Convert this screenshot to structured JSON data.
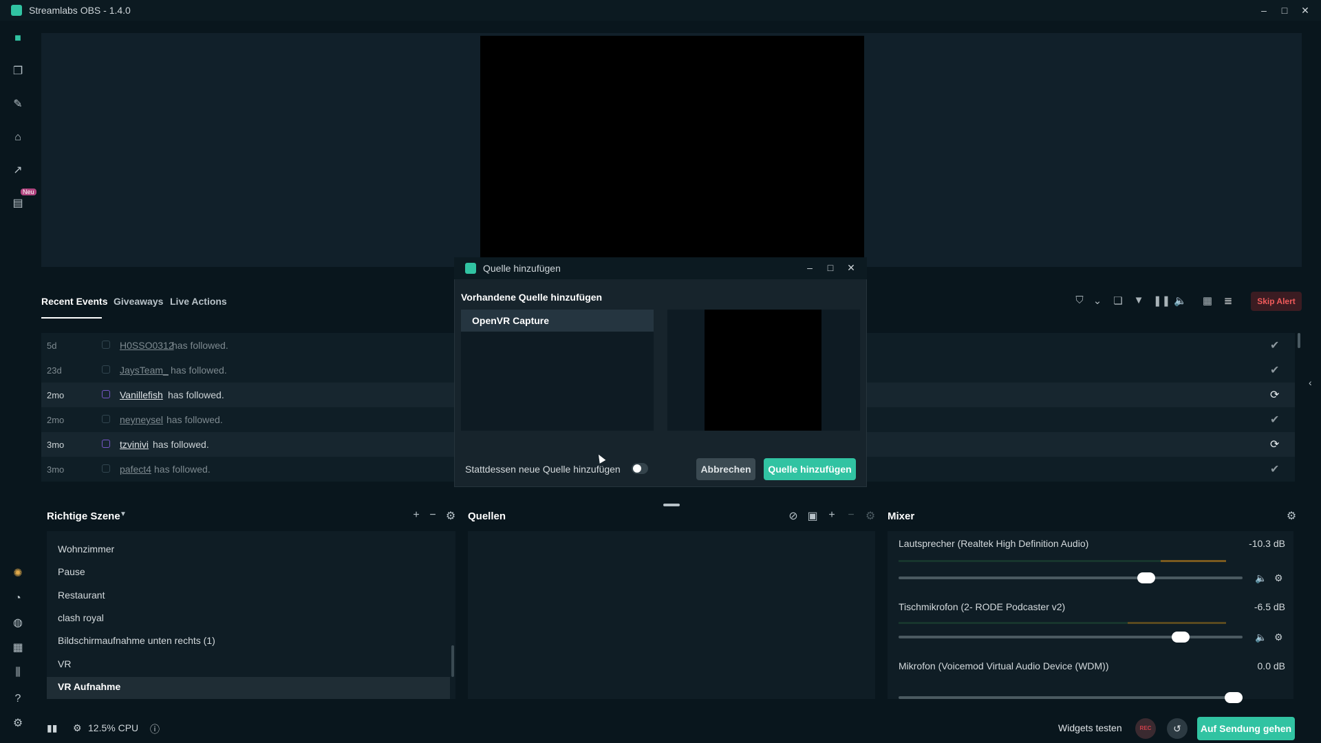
{
  "window": {
    "title": "Streamlabs OBS - 1.4.0",
    "controls": [
      "–",
      "□",
      "✕"
    ]
  },
  "sidebar": {
    "top_icons": [
      "studio-icon",
      "themes-icon",
      "editor-icon",
      "store-icon",
      "analytics-icon",
      "highlighter-icon"
    ],
    "new_badge": "Neu",
    "bottom_icons": [
      "prime-icon",
      "dashboard-icon",
      "chat-icon",
      "layouts-icon",
      "library-icon",
      "help-icon",
      "settings-icon"
    ]
  },
  "events": {
    "tabs": [
      "Recent Events",
      "Giveaways",
      "Live Actions"
    ],
    "skip_alert": "Skip Alert",
    "rows": [
      {
        "age": "5d",
        "user": "H0SSO0312",
        "action": "has followed.",
        "highlight": false
      },
      {
        "age": "23d",
        "user": "JaysTeam_",
        "action": "has followed.",
        "highlight": false
      },
      {
        "age": "2mo",
        "user": "Vanillefish",
        "action": "has followed.",
        "highlight": true
      },
      {
        "age": "2mo",
        "user": "neyneysel",
        "action": "has followed.",
        "highlight": false
      },
      {
        "age": "3mo",
        "user": "tzvinivi",
        "action": "has followed.",
        "highlight": true
      },
      {
        "age": "3mo",
        "user": "pafect4",
        "action": "has followed.",
        "highlight": false
      }
    ]
  },
  "scenes": {
    "title": "Richtige Szene",
    "items": [
      "Wohnzimmer",
      "Pause",
      "Restaurant",
      "clash royal",
      "Bildschirmaufnahme unten rechts (1)",
      "VR",
      "VR Aufnahme"
    ],
    "active": "VR Aufnahme"
  },
  "sources": {
    "title": "Quellen"
  },
  "mixer": {
    "title": "Mixer",
    "channels": [
      {
        "name": "Lautsprecher (Realtek High Definition Audio)",
        "db": "-10.3 dB",
        "level": 0.72
      },
      {
        "name": "Tischmikrofon (2- RODE Podcaster v2)",
        "db": "-6.5 dB",
        "level": 0.82
      },
      {
        "name": "Mikrofon (Voicemod Virtual Audio Device (WDM))",
        "db": "0.0 dB",
        "level": 1.0
      }
    ]
  },
  "footer": {
    "cpu": "12.5% CPU",
    "widgets_test": "Widgets testen",
    "rec": "REC",
    "go_live": "Auf Sendung gehen"
  },
  "modal": {
    "title": "Quelle hinzufügen",
    "heading": "Vorhandene Quelle hinzufügen",
    "selected_source": "OpenVR Capture",
    "toggle_label": "Stattdessen neue Quelle hinzufügen",
    "cancel": "Abbrechen",
    "confirm": "Quelle hinzufügen"
  },
  "colors": {
    "accent": "#31c3a2",
    "background": "#09161d",
    "alert": "#f05b5b"
  }
}
